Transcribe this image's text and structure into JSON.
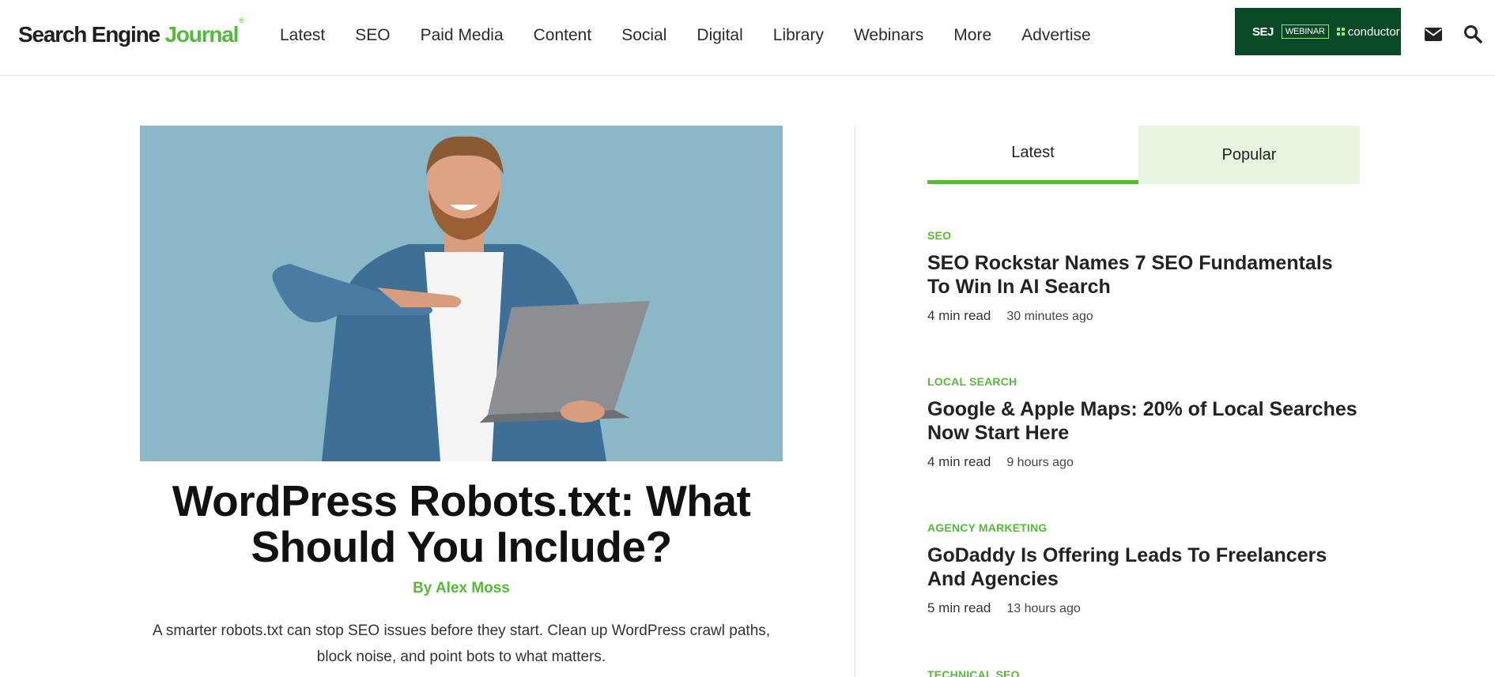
{
  "header": {
    "logo": {
      "part1": "Search Engine",
      "part2": "Journal",
      "mark": "®"
    },
    "nav": [
      "Latest",
      "SEO",
      "Paid Media",
      "Content",
      "Social",
      "Digital",
      "Library",
      "Webinars",
      "More",
      "Advertise"
    ],
    "banner": {
      "sej": "SEJ",
      "webinar": "WEBINAR",
      "partner": "conductor"
    },
    "icons": {
      "mail": "envelope-icon",
      "search": "search-icon"
    }
  },
  "article": {
    "title": "WordPress Robots.txt: What Should You Include?",
    "author_prefix": "By",
    "author": "Alex Moss",
    "excerpt": "A smarter robots.txt can stop SEO issues before they start. Clean up WordPress crawl paths, block noise, and point bots to what matters."
  },
  "sidebar": {
    "tabs": {
      "latest": "Latest",
      "popular": "Popular"
    },
    "items": [
      {
        "category": "SEO",
        "headline": "SEO Rockstar Names 7 SEO Fundamentals To Win In AI Search",
        "read": "4 min read",
        "ago": "30 minutes ago"
      },
      {
        "category": "Local Search",
        "headline": "Google & Apple Maps: 20% of Local Searches Now Start Here",
        "read": "4 min read",
        "ago": "9 hours ago"
      },
      {
        "category": "Agency Marketing",
        "headline": "GoDaddy Is Offering Leads To Freelancers And Agencies",
        "read": "5 min read",
        "ago": "13 hours ago"
      },
      {
        "category": "Technical SEO"
      }
    ]
  },
  "colors": {
    "brand_green": "#56b937",
    "banner_green": "#0b4a26",
    "tab_popular_bg": "#e6f5df",
    "hero_bg": "#8ab8c7"
  }
}
